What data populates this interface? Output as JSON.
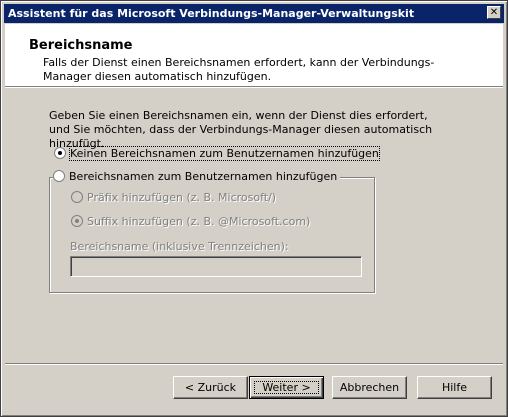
{
  "window": {
    "title": "Assistent für das Microsoft Verbindungs-Manager-Verwaltungskit",
    "close_glyph": "✕"
  },
  "header": {
    "title": "Bereichsname",
    "description": "Falls der Dienst einen Bereichsnamen erfordert, kann der Verbindungs-Manager diesen automatisch hinzufügen."
  },
  "main": {
    "intro": "Geben Sie einen Bereichsnamen ein, wenn der Dienst dies erfordert, und Sie möchten, dass der Verbindungs-Manager diesen automatisch hinzufügt.",
    "option_none": "Keinen Bereichsnamen zum Benutzernamen hinzufügen",
    "option_add": "Bereichsnamen zum Benutzernamen hinzufügen",
    "prefix_option": "Präfix hinzufügen (z. B. Microsoft/)",
    "suffix_option": "Suffix hinzufügen (z. B. @Microsoft.com)",
    "field_label": "Bereichsname (inklusive Trennzeichen):",
    "field_value": ""
  },
  "buttons": {
    "back": "< Zurück",
    "next": "Weiter >",
    "cancel": "Abbrechen",
    "help": "Hilfe"
  }
}
